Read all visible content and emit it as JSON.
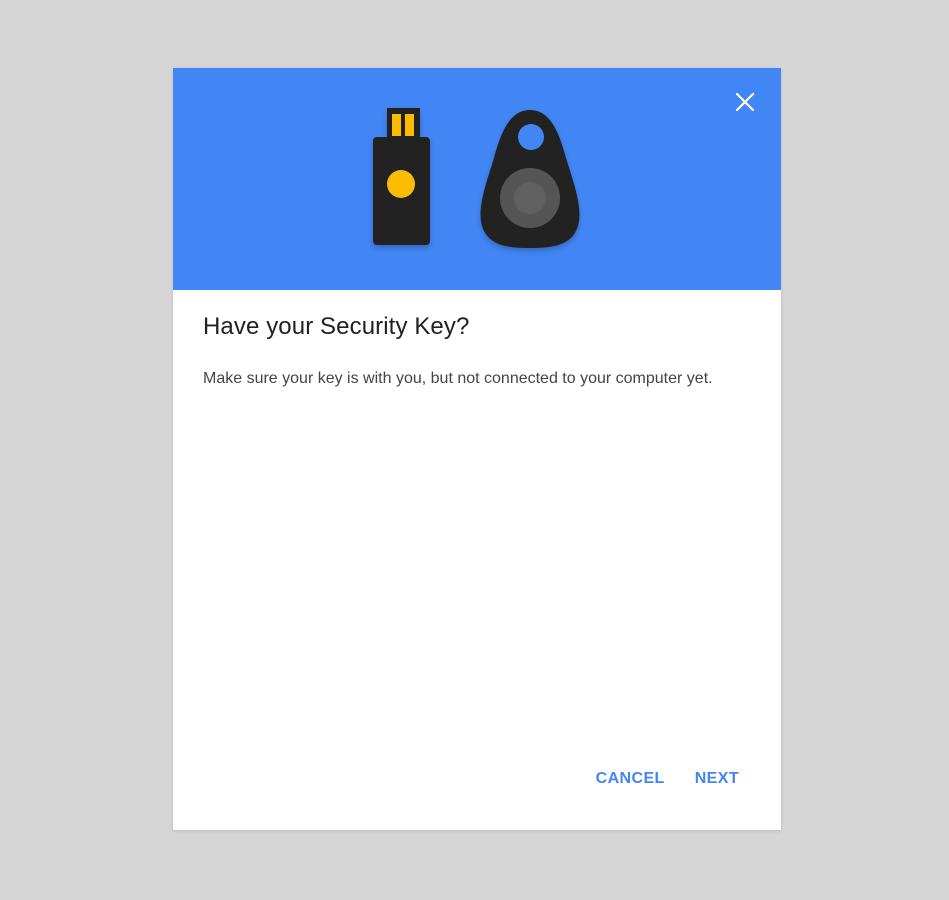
{
  "dialog": {
    "title": "Have your Security Key?",
    "body": "Make sure your key is with you, but not connected to your computer yet.",
    "header_color": "#4286f5",
    "accent_color": "#4286f5"
  },
  "header": {
    "close_icon": "close-icon",
    "illustration": {
      "usb_key_icon": "usb-security-key-icon",
      "fob_key_icon": "bluetooth-fob-security-key-icon",
      "key_body_color": "#202020",
      "usb_button_color": "#fbbc04",
      "fob_button_color": "#555555"
    }
  },
  "actions": {
    "cancel_label": "CANCEL",
    "next_label": "NEXT"
  }
}
